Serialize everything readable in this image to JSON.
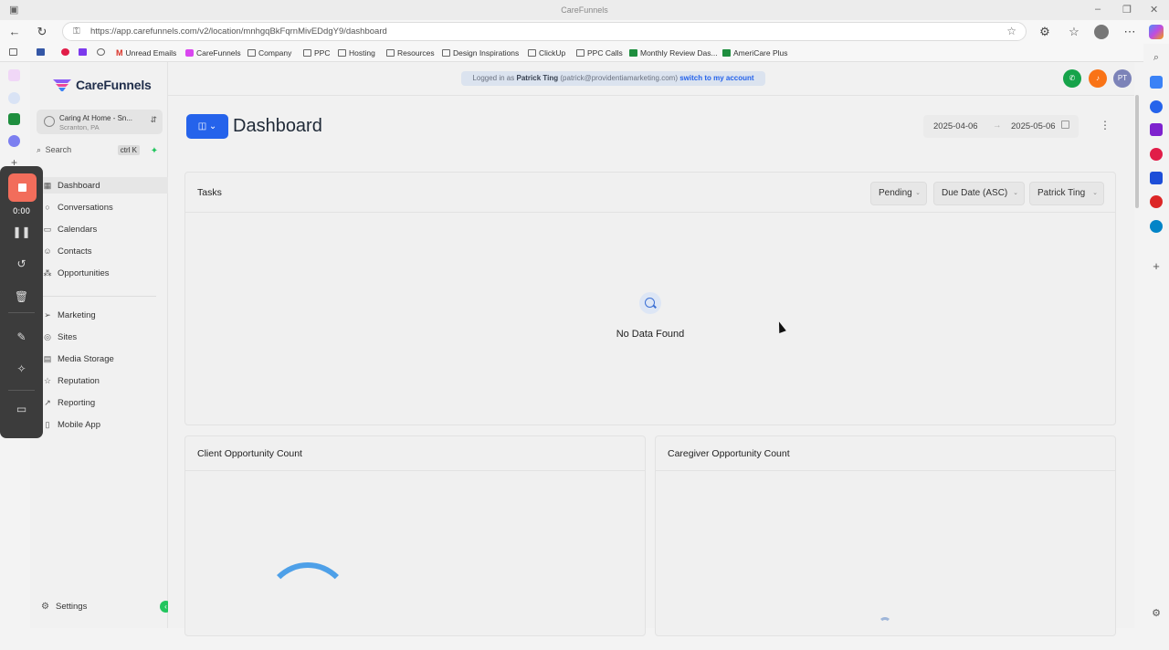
{
  "browser": {
    "window_title": "CareFunnels",
    "url": "https://app.carefunnels.com/v2/location/mnhgqBkFqrnMivEDdgY9/dashboard",
    "bookmarks": [
      {
        "label": "",
        "icon": "jw-icon"
      },
      {
        "label": "",
        "icon": "gear-icon"
      },
      {
        "label": "",
        "icon": "apps-icon"
      },
      {
        "label": "",
        "icon": "cloud-icon"
      },
      {
        "label": "Unread Emails",
        "icon": "gmail-icon"
      },
      {
        "label": "CareFunnels",
        "icon": "carefunnels-icon"
      },
      {
        "label": "Company",
        "icon": "folder-icon"
      },
      {
        "label": "PPC",
        "icon": "folder-icon"
      },
      {
        "label": "Hosting",
        "icon": "folder-icon"
      },
      {
        "label": "Resources",
        "icon": "folder-icon"
      },
      {
        "label": "Design Inspirations",
        "icon": "folder-icon"
      },
      {
        "label": "ClickUp",
        "icon": "folder-icon"
      },
      {
        "label": "PPC Calls",
        "icon": "folder-icon"
      },
      {
        "label": "Monthly Review Das...",
        "icon": "sheets-icon"
      },
      {
        "label": "AmeriCare Plus",
        "icon": "sheets-icon"
      }
    ]
  },
  "recorder": {
    "elapsed": "0:00"
  },
  "sidebar": {
    "brand": "CareFunnels",
    "account_name": "Caring At Home - Sn...",
    "account_location": "Scranton, PA",
    "search_placeholder": "Search",
    "search_shortcut": "ctrl K",
    "items": [
      {
        "label": "Dashboard",
        "icon": "grid-icon"
      },
      {
        "label": "Conversations",
        "icon": "chat-icon"
      },
      {
        "label": "Calendars",
        "icon": "calendar-icon"
      },
      {
        "label": "Contacts",
        "icon": "contacts-icon"
      },
      {
        "label": "Opportunities",
        "icon": "opportunities-icon"
      },
      {
        "label": "Marketing",
        "icon": "send-icon"
      },
      {
        "label": "Sites",
        "icon": "globe-icon"
      },
      {
        "label": "Media Storage",
        "icon": "storage-icon"
      },
      {
        "label": "Reputation",
        "icon": "star-icon"
      },
      {
        "label": "Reporting",
        "icon": "trend-icon"
      },
      {
        "label": "Mobile App",
        "icon": "mobile-icon"
      }
    ],
    "settings_label": "Settings"
  },
  "header": {
    "banner_prefix": "Logged in as",
    "banner_user": "Patrick Ting",
    "banner_email": "(patrick@providentiamarketing.com)",
    "banner_link": "switch to my account",
    "avatar_initials": "PT",
    "colors": {
      "phone": "#16a34a",
      "bell": "#f97316",
      "avatar": "#7c83b8"
    }
  },
  "dashboard": {
    "title": "Dashboard",
    "date_start": "2025-04-06",
    "date_end": "2025-05-06",
    "accent": "#2563eb"
  },
  "tasks": {
    "title": "Tasks",
    "filters": {
      "status": "Pending",
      "sort": "Due Date (ASC)",
      "assignee": "Patrick Ting"
    },
    "empty_text": "No Data Found"
  },
  "widgets": {
    "client_title": "Client Opportunity Count",
    "caregiver_title": "Caregiver Opportunity Count"
  }
}
